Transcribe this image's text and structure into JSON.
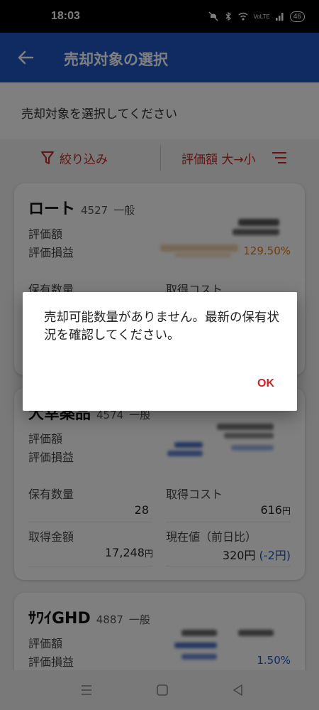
{
  "status_bar": {
    "time": "18:03",
    "battery": "46",
    "network": "VoLTE"
  },
  "header": {
    "title": "売却対象の選択"
  },
  "instruction": "売却対象を選択してください",
  "toolbar": {
    "filter_label": "絞り込み",
    "sort_label": "評価額 大→小"
  },
  "cards": [
    {
      "name": "ロート",
      "code": "4527",
      "account": "一般",
      "eval_label": "評価額",
      "pl_label": "評価損益",
      "pl_rate": "129.50%",
      "qty_label": "保有数量",
      "cost_label": "取得コスト"
    },
    {
      "name": "大幸薬品",
      "code": "4574",
      "account": "一般",
      "eval_label": "評価額",
      "pl_label": "評価損益",
      "qty_label": "保有数量",
      "qty_value": "28",
      "cost_label": "取得コスト",
      "cost_value": "616",
      "cost_unit": "円",
      "amount_label": "取得金額",
      "amount_value": "17,248",
      "amount_unit": "円",
      "price_label": "現在値（前日比）",
      "price_value": "320円",
      "price_change": "(-2円)"
    },
    {
      "name": "ｻﾜｲGHD",
      "code": "4887",
      "account": "一般",
      "eval_label": "評価額",
      "pl_label": "評価損益",
      "pl_rate": "1.50%"
    }
  ],
  "dialog": {
    "message": "売却可能数量がありません。最新の保有状況を確認してください。",
    "ok_label": "OK"
  },
  "colors": {
    "header": "#1e56c5",
    "accent_red": "#c62828",
    "profit_orange": "#e07b10",
    "change_blue": "#1e56c5"
  }
}
